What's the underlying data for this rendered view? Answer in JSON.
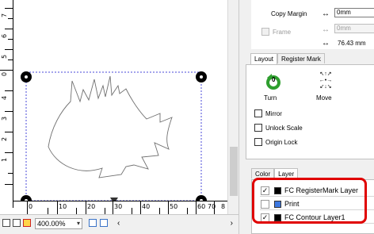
{
  "vertical_ruler": {
    "labels": [
      "0",
      "7",
      "6",
      "5",
      "4",
      "3",
      "2",
      "1"
    ]
  },
  "horizontal_ruler": {
    "labels": [
      "0",
      "10",
      "20",
      "30",
      "40",
      "50",
      "60",
      "70",
      "8"
    ]
  },
  "bottom_bar": {
    "zoom_value": "400.00%",
    "icons": [
      "grid-icon",
      "page-icon",
      "color-icon",
      "fit-icon",
      "select-icon"
    ]
  },
  "properties": {
    "copy_margin_label": "Copy Margin",
    "copy_margin_symbol": "↔",
    "copy_margin_value": "0mm",
    "frame_label": "Frame",
    "frame_symbol_1": "↔",
    "frame_value": "0mm",
    "frame_symbol_2": "↔",
    "frame_size": "76.43 mm"
  },
  "layout_tabs": [
    {
      "label": "Layout",
      "active": true
    },
    {
      "label": "Register Mark",
      "active": false
    }
  ],
  "layout_panel": {
    "turn_label": "Turn",
    "turn_value": "0",
    "move_label": "Move",
    "mirror_label": "Mirror",
    "unlock_scale_label": "Unlock Scale",
    "origin_lock_label": "Origin Lock"
  },
  "bottom_tabs": [
    {
      "label": "Color",
      "active": false
    },
    {
      "label": "Layer",
      "active": true
    }
  ],
  "layers": [
    {
      "name": "FC RegisterMark Layer",
      "checked": true,
      "color": "#000000"
    },
    {
      "name": "Print",
      "checked": false,
      "color": "#3d78e0"
    },
    {
      "name": "FC Contour Layer1",
      "checked": true,
      "color": "#000000"
    }
  ],
  "colors": {
    "highlight": "#e00000",
    "selection_border": "#4a4ad8"
  }
}
